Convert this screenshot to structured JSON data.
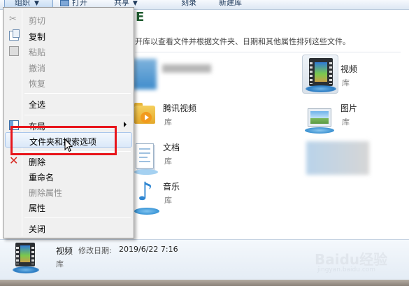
{
  "toolbar": {
    "organize_label": "组织",
    "open_label": "打开",
    "share_label": "共享",
    "burn_label": "刻录",
    "new_library_label": "新建库"
  },
  "library_description": "开库以查看文件并根据文件夹、日期和其他属性排列这些文件。",
  "libraries": [
    {
      "name": "腾讯视频",
      "type": "库",
      "icon": "tencent-video-folder-icon"
    },
    {
      "name": "文档",
      "type": "库",
      "icon": "document-library-icon"
    },
    {
      "name": "音乐",
      "type": "库",
      "icon": "music-note-icon"
    },
    {
      "name": "视频",
      "type": "库",
      "icon": "video-film-icon"
    },
    {
      "name": "图片",
      "type": "库",
      "icon": "picture-frame-icon"
    }
  ],
  "menu": {
    "cut": "剪切",
    "copy": "复制",
    "paste": "粘贴",
    "undo": "撤消",
    "redo": "恢复",
    "select_all": "全选",
    "layout": "布局",
    "folder_options": "文件夹和搜索选项",
    "delete": "删除",
    "rename": "重命名",
    "remove_properties": "删除属性",
    "properties": "属性",
    "close": "关闭"
  },
  "details": {
    "name": "视频",
    "modified_label": "修改日期:",
    "modified_value": "2019/6/22 7:16",
    "type": "库"
  },
  "watermark": {
    "brand": "Baidu经验",
    "sub": "jingyan.baidu.com"
  },
  "colors": {
    "highlight_box": "#e8151b",
    "menu_background": "#f0f0f0",
    "toolbar_blue": "#dde7f3"
  }
}
